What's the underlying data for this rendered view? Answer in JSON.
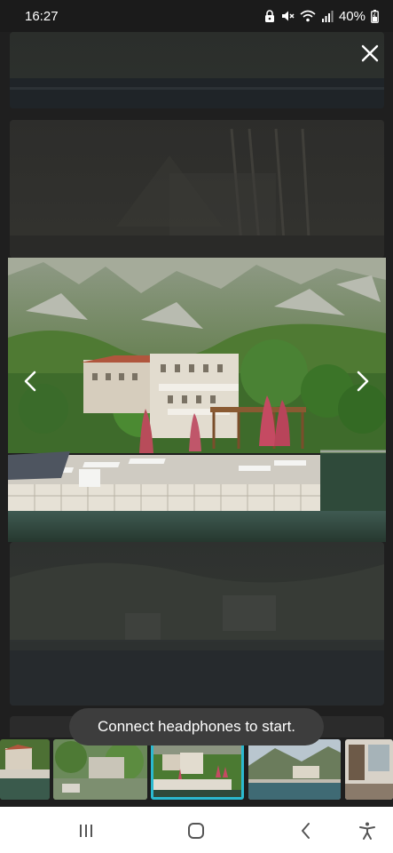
{
  "status_bar": {
    "time": "16:27",
    "battery": "40%",
    "icons": [
      "lock-icon",
      "mute-icon",
      "wifi-icon",
      "signal-icon",
      "battery-icon"
    ]
  },
  "viewer": {
    "close_icon": "close-icon",
    "prev_icon": "chevron-left-icon",
    "next_icon": "chevron-right-icon"
  },
  "toast": {
    "message": "Connect headphones to start."
  },
  "thumbnails": {
    "count": 6,
    "selected_index": 2,
    "accent_color": "#2bb9cf"
  },
  "nav_bar": {
    "icons": [
      "recent-apps-icon",
      "home-icon",
      "back-icon",
      "accessibility-icon"
    ]
  }
}
